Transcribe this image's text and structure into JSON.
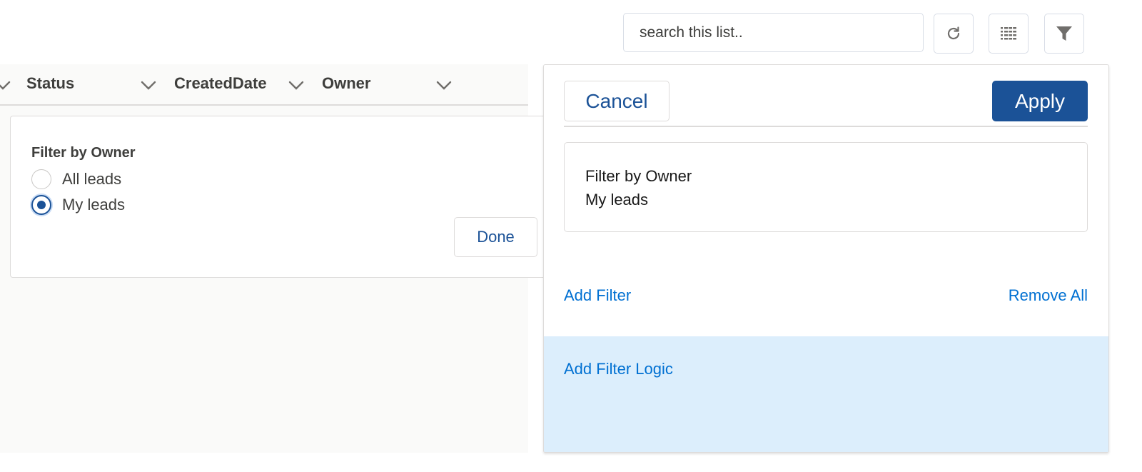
{
  "toolbar": {
    "search_placeholder": "search this list..",
    "refresh_icon": "refresh-icon",
    "list_view_icon": "list-view-icon",
    "filter_icon": "filter-icon"
  },
  "table": {
    "columns": [
      {
        "label": "Status"
      },
      {
        "label": "CreatedDate"
      },
      {
        "label": "Owner"
      }
    ]
  },
  "owner_filter_popover": {
    "title": "Filter by Owner",
    "options": [
      {
        "label": "All leads",
        "checked": false
      },
      {
        "label": "My leads",
        "checked": true
      }
    ],
    "done_label": "Done"
  },
  "filter_panel": {
    "cancel_label": "Cancel",
    "apply_label": "Apply",
    "filters": [
      {
        "title": "Filter by Owner",
        "value": "My leads"
      }
    ],
    "add_filter_label": "Add Filter",
    "remove_all_label": "Remove All",
    "add_filter_logic_label": "Add Filter Logic"
  },
  "colors": {
    "brand": "#1b5297",
    "link": "#0070d2",
    "logic_background": "#dceefc",
    "table_background": "#fafaf9"
  }
}
